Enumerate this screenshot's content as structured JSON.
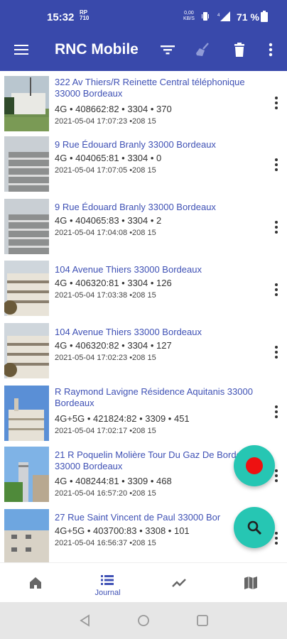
{
  "status_bar": {
    "time": "15:32",
    "rp_top": "RP",
    "rp_bottom": "710",
    "net_top": "0,00",
    "net_bottom": "KB/S",
    "battery_text": "71 %"
  },
  "app_bar": {
    "title": "RNC Mobile",
    "colors": {
      "primary": "#3949ab",
      "accent": "#26c6b3",
      "record": "#ee1111",
      "link": "#3f51b5"
    }
  },
  "entries": [
    {
      "address": "322 Av Thiers/R Reinette Central téléphonique 33000 Bordeaux",
      "info": "4G • 408662:82 • 3304 • 370",
      "date": "2021-05-04 17:07:23 •208 15"
    },
    {
      "address": "9 Rue Édouard Branly 33000 Bordeaux",
      "info": "4G • 404065:81 • 3304 • 0",
      "date": "2021-05-04 17:07:05 •208 15"
    },
    {
      "address": "9 Rue Édouard Branly 33000 Bordeaux",
      "info": "4G • 404065:83 • 3304 • 2",
      "date": "2021-05-04 17:04:08 •208 15"
    },
    {
      "address": "104 Avenue Thiers 33000 Bordeaux",
      "info": "4G • 406320:81 • 3304 • 126",
      "date": "2021-05-04 17:03:38 •208 15"
    },
    {
      "address": "104 Avenue Thiers 33000 Bordeaux",
      "info": "4G • 406320:82 • 3304 • 127",
      "date": "2021-05-04 17:02:23 •208 15"
    },
    {
      "address": "R Raymond Lavigne Résidence Aquitanis 33000 Bordeaux",
      "info": "4G+5G • 421824:82 • 3309 • 451",
      "date": "2021-05-04 17:02:17 •208 15"
    },
    {
      "address": "21 R Poquelin Molière Tour Du Gaz De Bordeaux 33000 Bordeaux",
      "info": "4G • 408244:81 • 3309 • 468",
      "date": "2021-05-04 16:57:20 •208 15"
    },
    {
      "address": "27 Rue Saint Vincent de Paul 33000 Bor",
      "info": "4G+5G • 403700:83 • 3308 • 101",
      "date": "2021-05-04 16:56:37 •208 15"
    }
  ],
  "bottom_nav": {
    "items": [
      {
        "icon": "home-icon",
        "label": ""
      },
      {
        "icon": "list-icon",
        "label": "Journal"
      },
      {
        "icon": "chart-line-icon",
        "label": ""
      },
      {
        "icon": "map-icon",
        "label": ""
      }
    ]
  }
}
